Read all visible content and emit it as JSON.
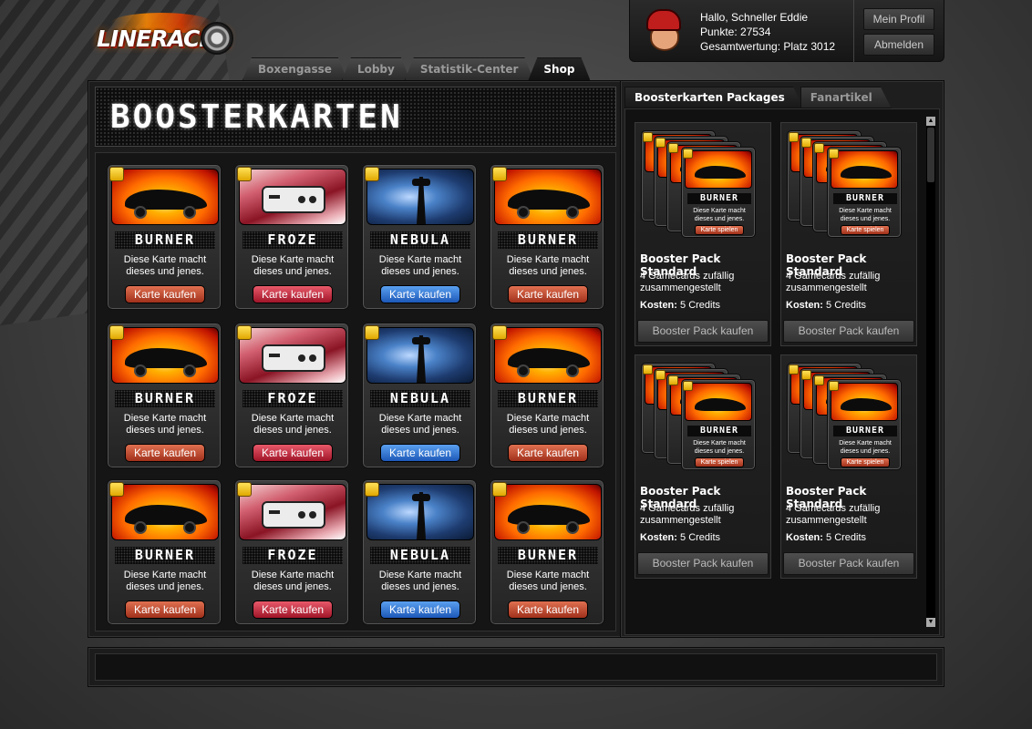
{
  "logo": {
    "text": "LINERACER"
  },
  "nav": {
    "tabs": [
      "Boxengasse",
      "Lobby",
      "Statistik-Center",
      "Shop"
    ],
    "active_index": 3
  },
  "user": {
    "greeting": "Hallo, Schneller Eddie",
    "points": "Punkte: 27534",
    "ranking": "Gesamtwertung: Platz 3012",
    "profile_button": "Mein Profil",
    "logout_button": "Abmelden"
  },
  "main": {
    "title": "BOOSTERKARTEN",
    "cards": [
      {
        "type": "burner",
        "name": "BURNER",
        "desc": "Diese Karte macht dieses und jenes.",
        "button": "Karte kaufen"
      },
      {
        "type": "froze",
        "name": "FROZE",
        "desc": "Diese Karte macht dieses und jenes.",
        "button": "Karte kaufen"
      },
      {
        "type": "nebula",
        "name": "NEBULA",
        "desc": "Diese Karte macht dieses und jenes.",
        "button": "Karte kaufen"
      },
      {
        "type": "burner",
        "name": "BURNER",
        "desc": "Diese Karte macht dieses und jenes.",
        "button": "Karte kaufen"
      },
      {
        "type": "burner",
        "name": "BURNER",
        "desc": "Diese Karte macht dieses und jenes.",
        "button": "Karte kaufen"
      },
      {
        "type": "froze",
        "name": "FROZE",
        "desc": "Diese Karte macht dieses und jenes.",
        "button": "Karte kaufen"
      },
      {
        "type": "nebula",
        "name": "NEBULA",
        "desc": "Diese Karte macht dieses und jenes.",
        "button": "Karte kaufen"
      },
      {
        "type": "burner",
        "name": "BURNER",
        "desc": "Diese Karte macht dieses und jenes.",
        "button": "Karte kaufen"
      },
      {
        "type": "burner",
        "name": "BURNER",
        "desc": "Diese Karte macht dieses und jenes.",
        "button": "Karte kaufen"
      },
      {
        "type": "froze",
        "name": "FROZE",
        "desc": "Diese Karte macht dieses und jenes.",
        "button": "Karte kaufen"
      },
      {
        "type": "nebula",
        "name": "NEBULA",
        "desc": "Diese Karte macht dieses und jenes.",
        "button": "Karte kaufen"
      },
      {
        "type": "burner",
        "name": "BURNER",
        "desc": "Diese Karte macht dieses und jenes.",
        "button": "Karte kaufen"
      }
    ]
  },
  "sidebar": {
    "tabs": [
      "Boosterkarten Packages",
      "Fanartikel"
    ],
    "active_index": 0,
    "packs": [
      {
        "title": "Booster Pack Standard",
        "desc": "4 Gamecards zufällig zusammengestellt",
        "cost_label": "Kosten:",
        "cost_value": "5 Credits",
        "button": "Booster Pack kaufen",
        "card_name": "BURNER",
        "card_desc": "Diese Karte macht dieses und jenes.",
        "card_button": "Karte spielen"
      },
      {
        "title": "Booster Pack Standard",
        "desc": "4 Gamecards zufällig zusammengestellt",
        "cost_label": "Kosten:",
        "cost_value": "5 Credits",
        "button": "Booster Pack kaufen",
        "card_name": "BURNER",
        "card_desc": "Diese Karte macht dieses und jenes.",
        "card_button": "Karte spielen"
      },
      {
        "title": "Booster Pack Standard",
        "desc": "4 Gamecards zufällig zusammengestellt",
        "cost_label": "Kosten:",
        "cost_value": "5 Credits",
        "button": "Booster Pack kaufen",
        "card_name": "BURNER",
        "card_desc": "Diese Karte macht dieses und jenes.",
        "card_button": "Karte spielen"
      },
      {
        "title": "Booster Pack Standard",
        "desc": "4 Gamecards zufällig zusammengestellt",
        "cost_label": "Kosten:",
        "cost_value": "5 Credits",
        "button": "Booster Pack kaufen",
        "card_name": "BURNER",
        "card_desc": "Diese Karte macht dieses und jenes.",
        "card_button": "Karte spielen"
      }
    ]
  },
  "icons": {
    "badge": "card-badge-icon",
    "scroll_up": "scroll-up-arrow-icon",
    "scroll_down": "scroll-down-arrow-icon"
  },
  "colors": {
    "burner_button": "#a0301a",
    "froze_button": "#a01428",
    "nebula_button": "#1c58b8",
    "badge": "#e0a800"
  }
}
